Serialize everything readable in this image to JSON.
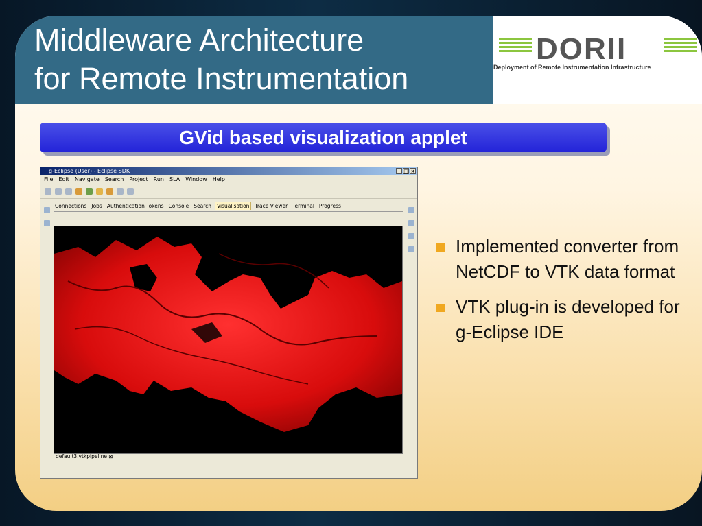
{
  "slide": {
    "title_line1": "Middleware Architecture",
    "title_line2": "for Remote Instrumentation",
    "logo_word": "DORII",
    "logo_tagline": "Deployment of Remote Instrumentation Infrastructure",
    "subtitle": "GVid based visualization applet"
  },
  "eclipse": {
    "window_title": "g-Eclipse (User) - Eclipse SDK",
    "menu": [
      "File",
      "Edit",
      "Navigate",
      "Search",
      "Project",
      "Run",
      "SLA",
      "Window",
      "Help"
    ],
    "tabs": [
      "Connections",
      "Jobs",
      "Authentication Tokens",
      "Console",
      "Search",
      "Visualisation",
      "Trace Viewer",
      "Terminal",
      "Progress"
    ],
    "active_tab": "Visualisation",
    "editor_tab": "default3.vtkpipeline"
  },
  "bullets": [
    "Implemented converter from NetCDF to VTK data format",
    "VTK plug-in is developed for g-Eclipse IDE"
  ],
  "colors": {
    "title_band": "#336a86",
    "subtitle_bg": "#2323d8",
    "bullet": "#f0a820",
    "render": "#e01010"
  }
}
